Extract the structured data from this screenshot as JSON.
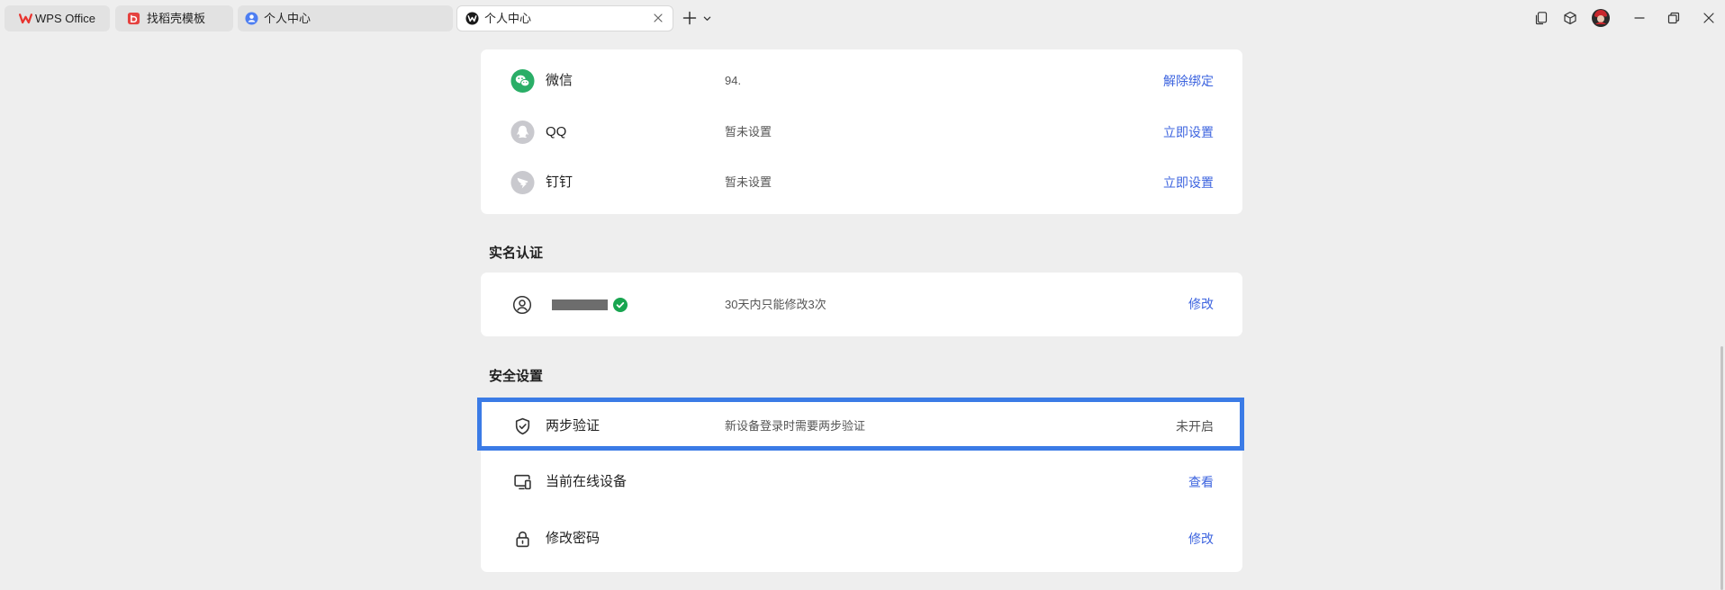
{
  "tabs": [
    {
      "label": "WPS Office",
      "icon": "wps-logo-icon"
    },
    {
      "label": "找稻壳模板",
      "icon": "docer-template-icon"
    },
    {
      "label": "个人中心",
      "icon": "user-center-icon"
    },
    {
      "label": "个人中心",
      "icon": "wps-w-icon",
      "active": true
    }
  ],
  "tab_actions": {
    "new_tab_icon": "plus-icon",
    "tab_menu_icon": "chevron-down-icon"
  },
  "window_icons": [
    "multi-window-icon",
    "cube-icon",
    "user-avatar",
    "minimize-icon",
    "restore-icon",
    "close-icon"
  ],
  "account_binding": {
    "rows": [
      {
        "name": "微信",
        "value": "94.",
        "action": "解除绑定",
        "icon": "wechat-icon"
      },
      {
        "name": "QQ",
        "value": "暂未设置",
        "action": "立即设置",
        "icon": "qq-icon"
      },
      {
        "name": "钉钉",
        "value": "暂未设置",
        "action": "立即设置",
        "icon": "dingtalk-icon"
      }
    ]
  },
  "real_name": {
    "title": "实名认证",
    "icon": "user-circle-icon",
    "verified": true,
    "note": "30天内只能修改3次",
    "action": "修改"
  },
  "security": {
    "title": "安全设置",
    "rows": [
      {
        "name": "两步验证",
        "value": "新设备登录时需要两步验证",
        "status": "未开启",
        "icon": "shield-check-icon",
        "highlighted": true
      },
      {
        "name": "当前在线设备",
        "action": "查看",
        "icon": "devices-icon"
      },
      {
        "name": "修改密码",
        "action": "修改",
        "icon": "lock-icon"
      }
    ]
  },
  "colors": {
    "link": "#3d64df",
    "page_bg": "#eeeeee",
    "card_bg": "#ffffff",
    "wechat": "#2aae67",
    "muted_icon": "#c9c9ce",
    "verified": "#18a550",
    "highlight": "#3b7be6"
  }
}
